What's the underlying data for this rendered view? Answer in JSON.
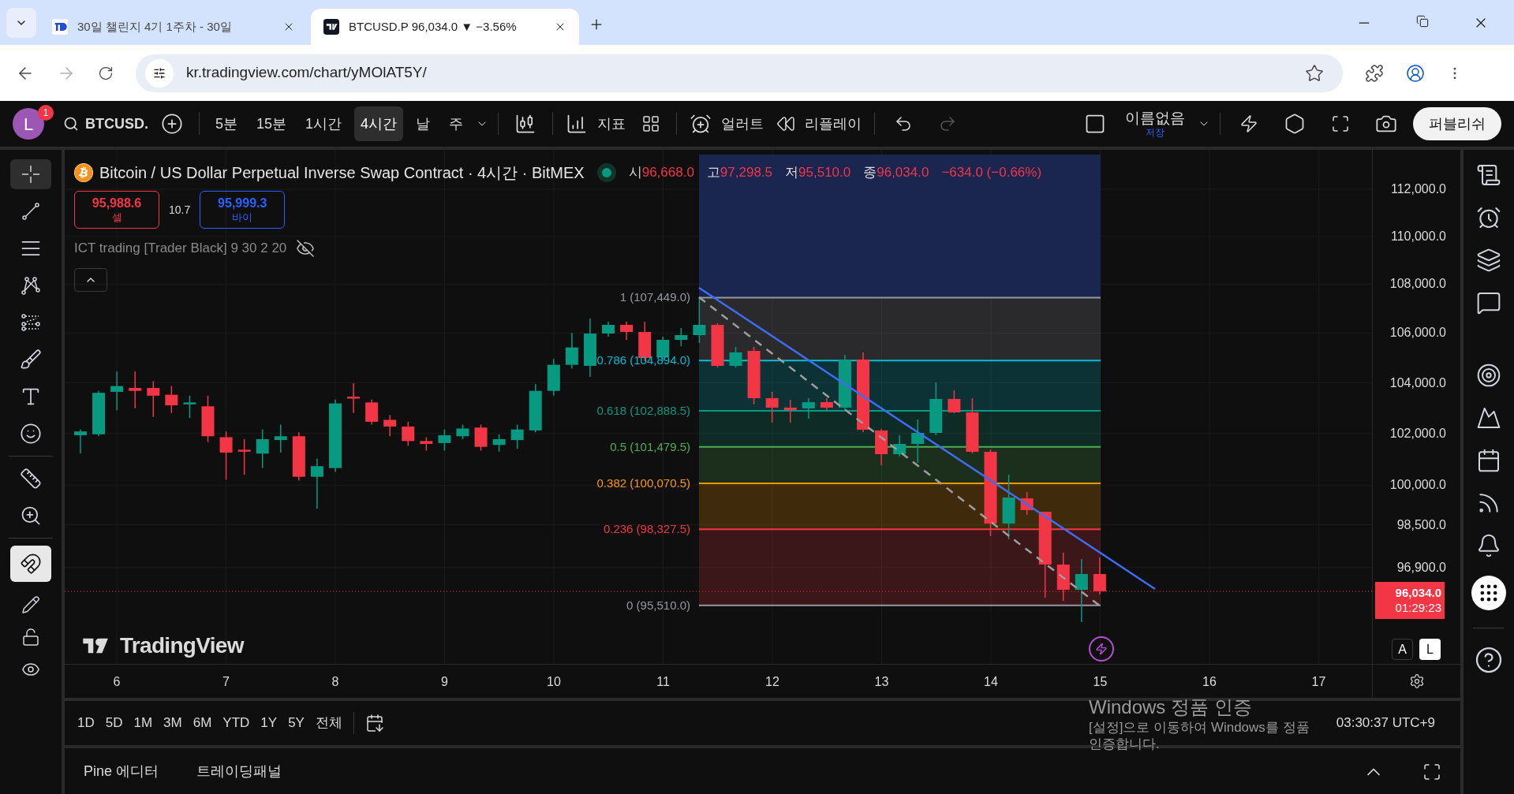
{
  "browser": {
    "tabs": [
      {
        "title": "30일 챌린지 4기 1주차 - 30일",
        "selected": false
      },
      {
        "title": "BTCUSD.P 96,034.0 ▼ −3.56%",
        "selected": true
      }
    ],
    "url": "kr.tradingview.com/chart/yMOlAT5Y/"
  },
  "toolbar": {
    "avatar": "L",
    "notifications": "1",
    "symbol": "BTCUSD.",
    "intervals": [
      {
        "label": "5분",
        "selected": false
      },
      {
        "label": "15분",
        "selected": false
      },
      {
        "label": "1시간",
        "selected": false
      },
      {
        "label": "4시간",
        "selected": true
      },
      {
        "label": "날",
        "selected": false
      },
      {
        "label": "주",
        "selected": false
      }
    ],
    "indicators": "지표",
    "alert": "얼러트",
    "replay": "리플레이",
    "layout_name": "이름없음",
    "save": "저장",
    "publish": "퍼블리쉬"
  },
  "drawing_tools": [
    {
      "selected": true
    },
    {
      "selected": false
    },
    {
      "selected": false
    },
    {
      "selected": false
    },
    {
      "selected": false
    },
    {
      "selected": false
    },
    {
      "selected": false
    },
    {
      "selected": false
    },
    {
      "selected": false
    },
    {
      "selected": false
    }
  ],
  "magnet": {
    "on": true
  },
  "legend": {
    "title": "Bitcoin / US Dollar Perpetual Inverse Swap Contract · 4시간 · BitMEX",
    "ohlc": [
      {
        "label": "시",
        "value": "96,668.0"
      },
      {
        "label": "고",
        "value": "97,298.5"
      },
      {
        "label": "저",
        "value": "95,510.0"
      },
      {
        "label": "종",
        "value": "96,034.0"
      }
    ],
    "change": "−634.0 (−0.66%)",
    "sell": {
      "price": "95,988.6",
      "label": "셀"
    },
    "spread": "10.7",
    "buy": {
      "price": "95,999.3",
      "label": "바이"
    },
    "indicator": "ICT trading [Trader Black] 9 30 2 20"
  },
  "fib_levels": [
    {
      "label": "1 (107,449.0)",
      "color": "#9598a1"
    },
    {
      "label": "0.786 (104,894.0)",
      "color": "#00bcd4"
    },
    {
      "label": "0.618 (102,888.5)",
      "color": "#089981"
    },
    {
      "label": "0.5 (101,479.5)",
      "color": "#4caf50"
    },
    {
      "label": "0.382 (100,070.5)",
      "color": "#ff9800"
    },
    {
      "label": "0.236 (98,327.5)",
      "color": "#f23645"
    },
    {
      "label": "0 (95,510.0)",
      "color": "#9598a1"
    }
  ],
  "watermark_logo": "TradingView",
  "price_axis": {
    "ticks": [
      "112,000.0",
      "110,000.0",
      "108,000.0",
      "106,000.0",
      "104,000.0",
      "102,000.0",
      "100,000.0",
      "98,500.0",
      "96,900.0"
    ],
    "current_price": "96,034.0",
    "countdown": "01:29:23",
    "scale_buttons": [
      {
        "label": "A",
        "selected": false
      },
      {
        "label": "L",
        "selected": true
      }
    ]
  },
  "time_axis": [
    "6",
    "7",
    "8",
    "9",
    "10",
    "11",
    "12",
    "13",
    "14",
    "15",
    "16",
    "17"
  ],
  "range_bar": {
    "ranges": [
      "1D",
      "5D",
      "1M",
      "3M",
      "6M",
      "YTD",
      "1Y",
      "5Y",
      "전체"
    ],
    "time": "03:30:37 UTC+9"
  },
  "bottom_panel": {
    "tabs": [
      "Pine 에디터",
      "트레이딩패널"
    ]
  },
  "os_overlay": {
    "title": "Windows 정품 인증",
    "message": "[설정]으로 이동하여 Windows를 정품 인증합니다."
  }
}
